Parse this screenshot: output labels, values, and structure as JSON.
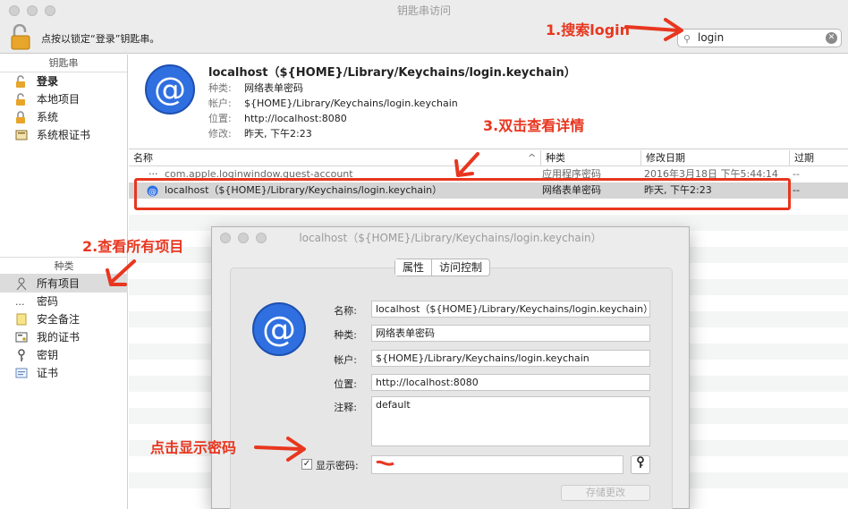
{
  "window": {
    "title": "钥匙串访问",
    "lock_text": "点按以锁定“登录”钥匙串。"
  },
  "search": {
    "value": "login"
  },
  "sidebar": {
    "keychains_header": "钥匙串",
    "keychains": [
      {
        "label": "登录",
        "icon": "unlocked-padlock-icon",
        "bold": true
      },
      {
        "label": "本地项目",
        "icon": "unlocked-padlock-icon"
      },
      {
        "label": "系统",
        "icon": "locked-padlock-icon"
      },
      {
        "label": "系统根证书",
        "icon": "certificate-folder-icon"
      }
    ],
    "category_header": "种类",
    "categories": [
      {
        "label": "所有项目",
        "icon": "all-items-icon",
        "selected": true
      },
      {
        "label": "密码",
        "icon": "password-icon"
      },
      {
        "label": "安全备注",
        "icon": "secure-note-icon"
      },
      {
        "label": "我的证书",
        "icon": "my-certificate-icon"
      },
      {
        "label": "密钥",
        "icon": "key-icon"
      },
      {
        "label": "证书",
        "icon": "certificate-icon"
      }
    ]
  },
  "detail": {
    "title": "localhost（${HOME}/Library/Keychains/login.keychain）",
    "kind_label": "种类:",
    "kind_value": "网络表单密码",
    "account_label": "帐户:",
    "account_value": "${HOME}/Library/Keychains/login.keychain",
    "where_label": "位置:",
    "where_value": "http://localhost:8080",
    "modified_label": "修改:",
    "modified_value": "昨天, 下午2:23"
  },
  "table": {
    "headers": {
      "name": "名称",
      "kind": "种类",
      "modified": "修改日期",
      "expires": "过期"
    },
    "rows": [
      {
        "name": "com.apple.loginwindow.guest-account",
        "kind": "应用程序密码",
        "modified": "2016年3月18日 下午5:44:14",
        "expires": "--"
      },
      {
        "name": "localhost（${HOME}/Library/Keychains/login.keychain）",
        "kind": "网络表单密码",
        "modified": "昨天, 下午2:23",
        "expires": "--"
      }
    ]
  },
  "dialog": {
    "title": "localhost（${HOME}/Library/Keychains/login.keychain）",
    "tabs": [
      "属性",
      "访问控制"
    ],
    "name_label": "名称:",
    "name_value": "localhost（${HOME}/Library/Keychains/login.keychain）",
    "kind_label": "种类:",
    "kind_value": "网络表单密码",
    "account_label": "帐户:",
    "account_value": "${HOME}/Library/Keychains/login.keychain",
    "where_label": "位置:",
    "where_value": "http://localhost:8080",
    "comment_label": "注释:",
    "comment_value": "default",
    "show_password_label": "显示密码:",
    "show_password_checked": "✓",
    "save_label": "存储更改"
  },
  "annotations": {
    "step1": "1.搜索login",
    "step2": "2.查看所有项目",
    "step3": "3.双击查看详情",
    "step4": "点击显示密码"
  },
  "colors": {
    "annotation_red": "#e8361f",
    "icon_blue": "#2f6fe0"
  }
}
